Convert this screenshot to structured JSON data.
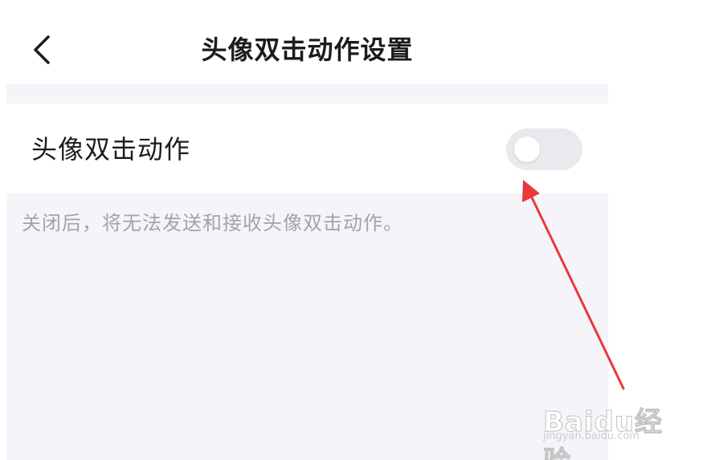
{
  "header": {
    "title": "头像双击动作设置",
    "back_icon": "chevron-left-icon"
  },
  "setting": {
    "label": "头像双击动作",
    "toggle_on": false,
    "toggle_track_color": "#e9e9ee",
    "toggle_knob_color": "#ffffff"
  },
  "hint": {
    "text": "关闭后，将无法发送和接收头像双击动作。"
  },
  "annotation": {
    "arrow_color": "#e8383d"
  },
  "watermark": {
    "logo_text": "Baidu经验",
    "url": "jingyan.baidu.com"
  },
  "colors": {
    "background": "#ffffff",
    "section_background": "#f5f5f9",
    "primary_text": "#1c1c1e",
    "secondary_text": "#a3a3a8"
  }
}
